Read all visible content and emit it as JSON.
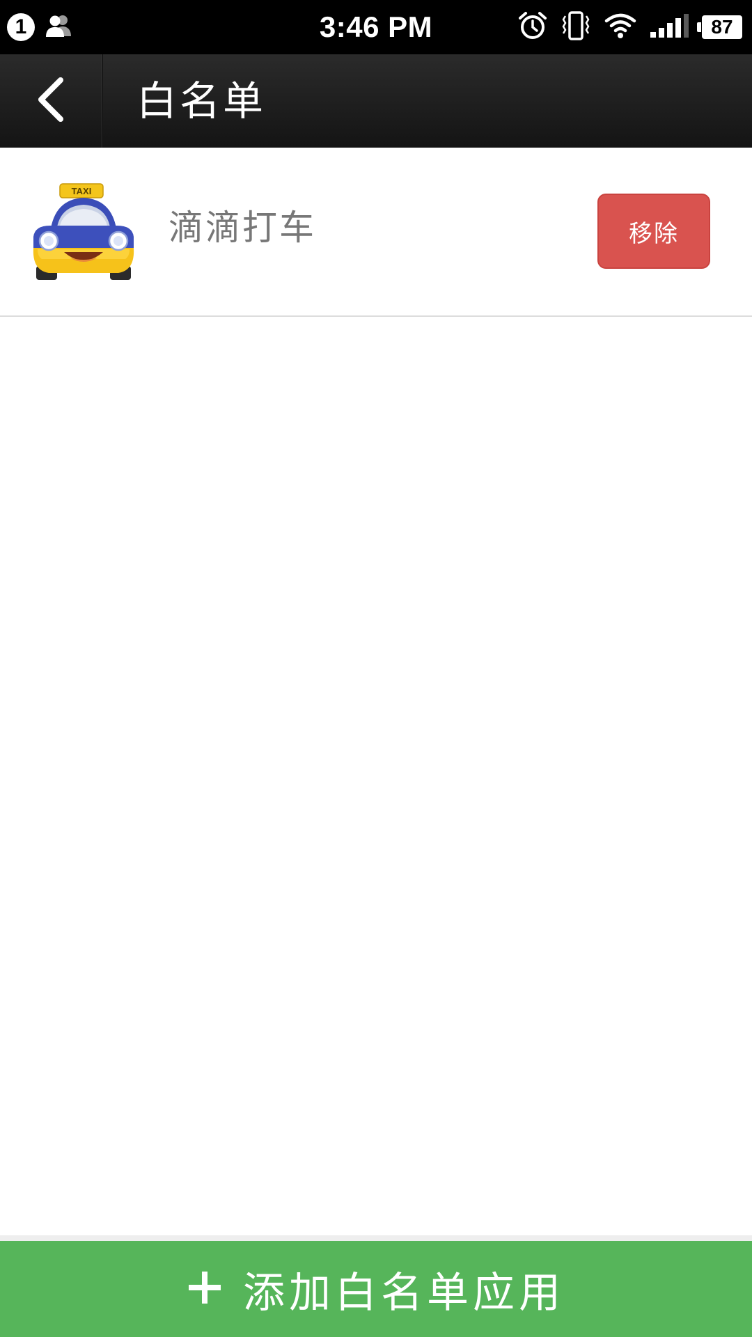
{
  "status_bar": {
    "notification_count": "1",
    "time": "3:46 PM",
    "battery_level": "87",
    "icons": [
      "contacts-icon",
      "alarm-icon",
      "vibrate-icon",
      "wifi-icon",
      "signal-icon",
      "battery-icon"
    ]
  },
  "header": {
    "back_icon": "chevron-left-icon",
    "title": "白名单"
  },
  "whitelist": {
    "items": [
      {
        "icon": "taxi-app-icon",
        "icon_text": "TAXI",
        "name": "滴滴打车",
        "remove_label": "移除"
      }
    ]
  },
  "footer": {
    "add_icon": "plus-icon",
    "add_label": "添加白名单应用"
  },
  "colors": {
    "status_bar": "#000000",
    "title_bar": "#1f1f1f",
    "remove_button": "#d9534f",
    "add_button": "#56b55a",
    "app_name_text": "#777777"
  }
}
